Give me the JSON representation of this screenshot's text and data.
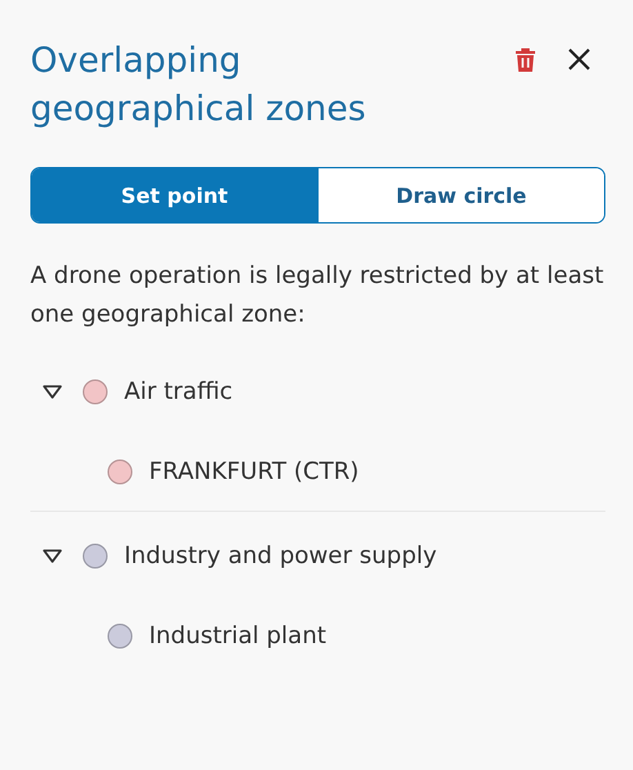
{
  "panel": {
    "title": "Overlapping geographical zones"
  },
  "modes": [
    {
      "label": "Set point",
      "selected": true
    },
    {
      "label": "Draw circle",
      "selected": false
    }
  ],
  "description": "A drone operation is legally restricted by at least one geographical zone:",
  "zone_groups": [
    {
      "label": "Air traffic",
      "color": "#f2c4c6",
      "expanded": true,
      "children": [
        {
          "label": "FRANKFURT (CTR)",
          "color": "#f2c4c6"
        }
      ]
    },
    {
      "label": "Industry and power supply",
      "color": "#cbcbdc",
      "expanded": true,
      "children": [
        {
          "label": "Industrial plant",
          "color": "#cbcbdc"
        }
      ]
    }
  ]
}
